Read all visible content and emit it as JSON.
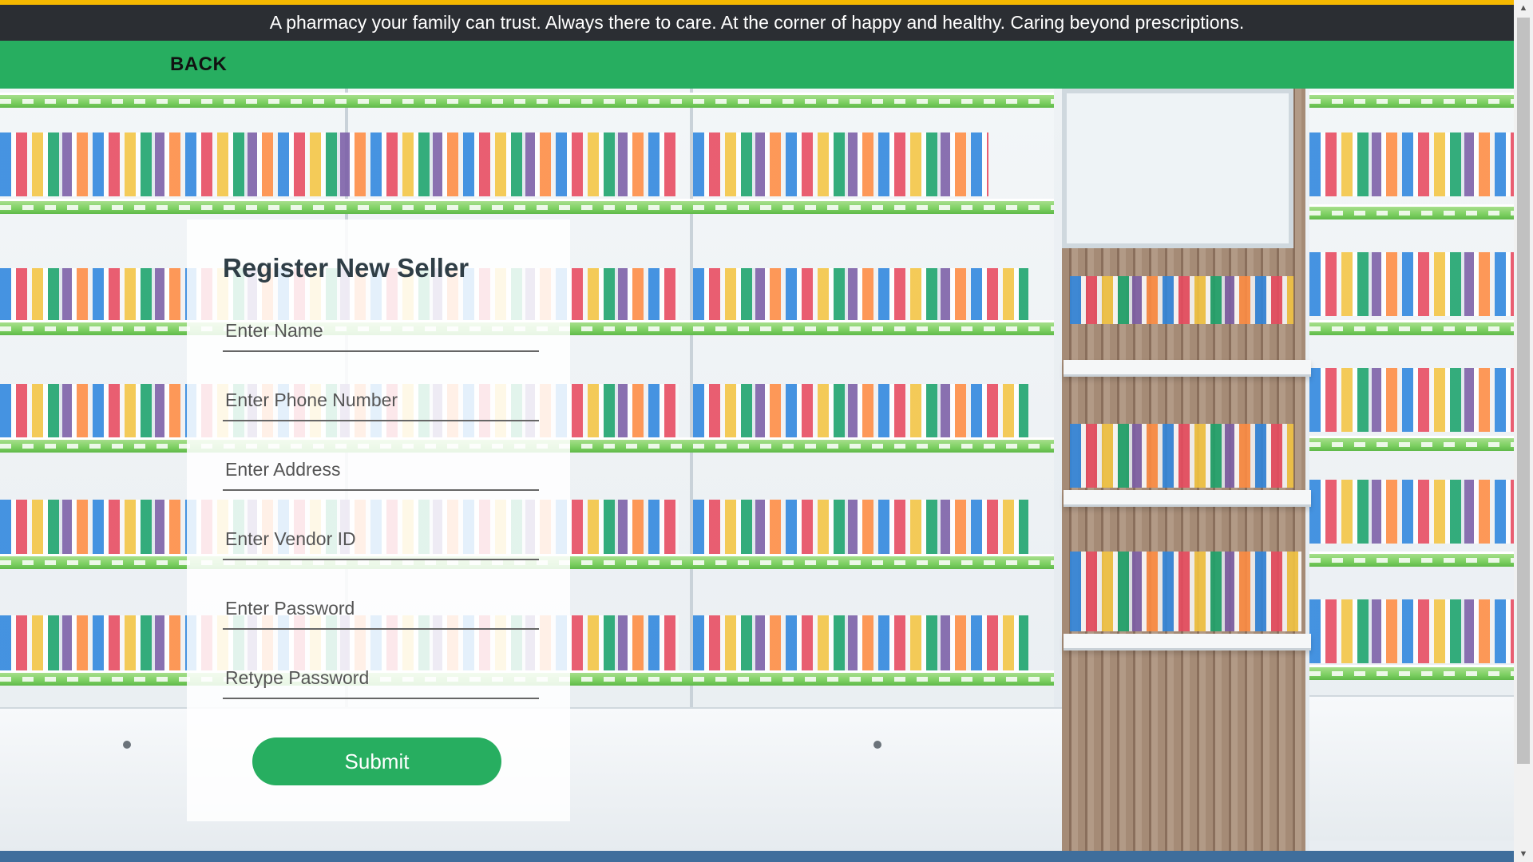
{
  "banner": {
    "text": "A pharmacy your family can trust. Always there to care. At the corner of happy and healthy. Caring beyond prescriptions."
  },
  "nav": {
    "back_label": "BACK"
  },
  "form": {
    "title": "Register New Seller",
    "fields": [
      {
        "name": "name",
        "placeholder": "Enter Name",
        "value": ""
      },
      {
        "name": "phone",
        "placeholder": "Enter Phone Number",
        "value": ""
      },
      {
        "name": "address",
        "placeholder": "Enter Address",
        "value": ""
      },
      {
        "name": "vendor_id",
        "placeholder": "Enter Vendor ID",
        "value": ""
      },
      {
        "name": "password",
        "placeholder": "Enter Password",
        "value": ""
      },
      {
        "name": "retype_password",
        "placeholder": "Retype Password",
        "value": ""
      }
    ],
    "submit_label": "Submit"
  },
  "scrollbar": {
    "up_icon": "triangle-up-icon",
    "down_icon": "triangle-down-icon"
  },
  "colors": {
    "accent_top": "#f5b800",
    "banner_bg": "#2b2e33",
    "nav_green": "#27ae60",
    "button_green": "#27ae60",
    "title_text": "#2f3e46"
  }
}
